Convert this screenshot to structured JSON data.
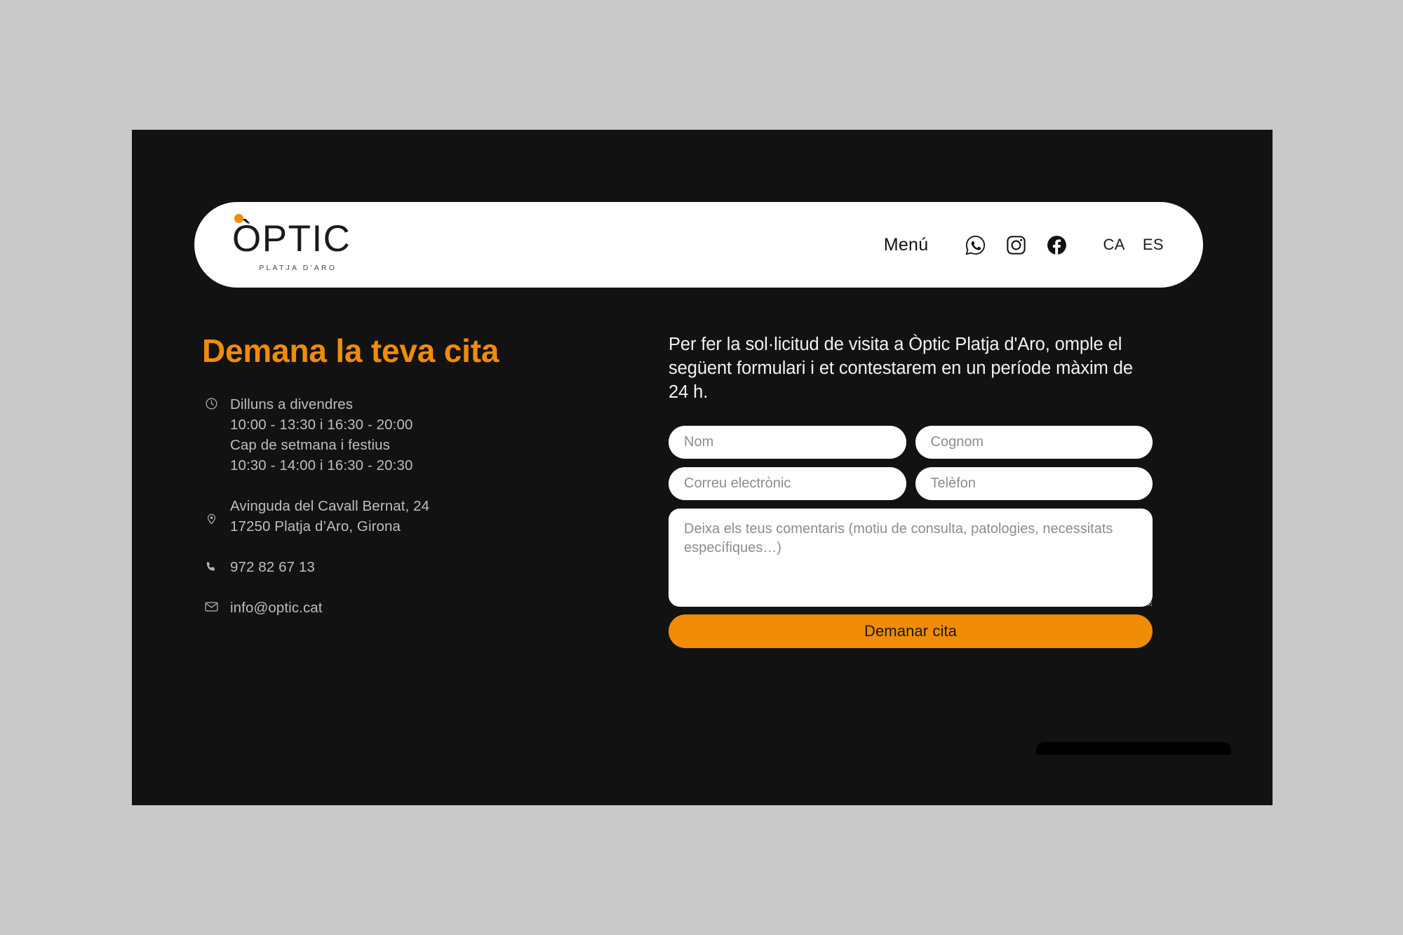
{
  "colors": {
    "page_background": "#c9c9c9",
    "panel_background": "#121212",
    "accent_orange": "#f08c06",
    "pill_white": "#ffffff",
    "muted_text": "#bdbdbd"
  },
  "header": {
    "logo": {
      "wordmark": "ÒPTIC",
      "subtitle": "PLATJA  D'ARO",
      "dot_icon": "orange-accent-dot"
    },
    "menu_label": "Menú",
    "social": [
      {
        "name": "whatsapp-icon",
        "label": "WhatsApp"
      },
      {
        "name": "instagram-icon",
        "label": "Instagram"
      },
      {
        "name": "facebook-icon",
        "label": "Facebook"
      }
    ],
    "languages": [
      {
        "code": "CA",
        "active": true
      },
      {
        "code": "ES",
        "active": false
      }
    ]
  },
  "main": {
    "title": "Demana la teva cita",
    "info": {
      "hours": {
        "icon": "clock-icon",
        "line1": "Dilluns a divendres",
        "line2": "10:00 - 13:30 i 16:30 - 20:00",
        "line3": "Cap de setmana i festius",
        "line4": "10:30 - 14:00 i 16:30 - 20:30"
      },
      "address": {
        "icon": "location-pin-icon",
        "line1": "Avinguda del Cavall Bernat, 24",
        "line2": "17250 Platja d’Aro, Girona"
      },
      "phone": {
        "icon": "phone-icon",
        "value": "972 82 67 13"
      },
      "email": {
        "icon": "envelope-icon",
        "value": "info@optic.cat"
      }
    },
    "intro": "Per fer la sol·licitud de visita a Òptic Platja d'Aro, omple el següent formulari i et contestarem en un període màxim de 24 h.",
    "form": {
      "first_name_placeholder": "Nom",
      "first_name_value": "",
      "last_name_placeholder": "Cognom",
      "last_name_value": "",
      "email_placeholder": "Correu electrònic",
      "email_value": "",
      "phone_placeholder": "Telèfon",
      "phone_value": "",
      "comments_placeholder": "Deixa els teus comentaris (motiu de consulta, patologies, necessitats específiques…)",
      "comments_value": "",
      "submit_label": "Demanar cita"
    }
  }
}
